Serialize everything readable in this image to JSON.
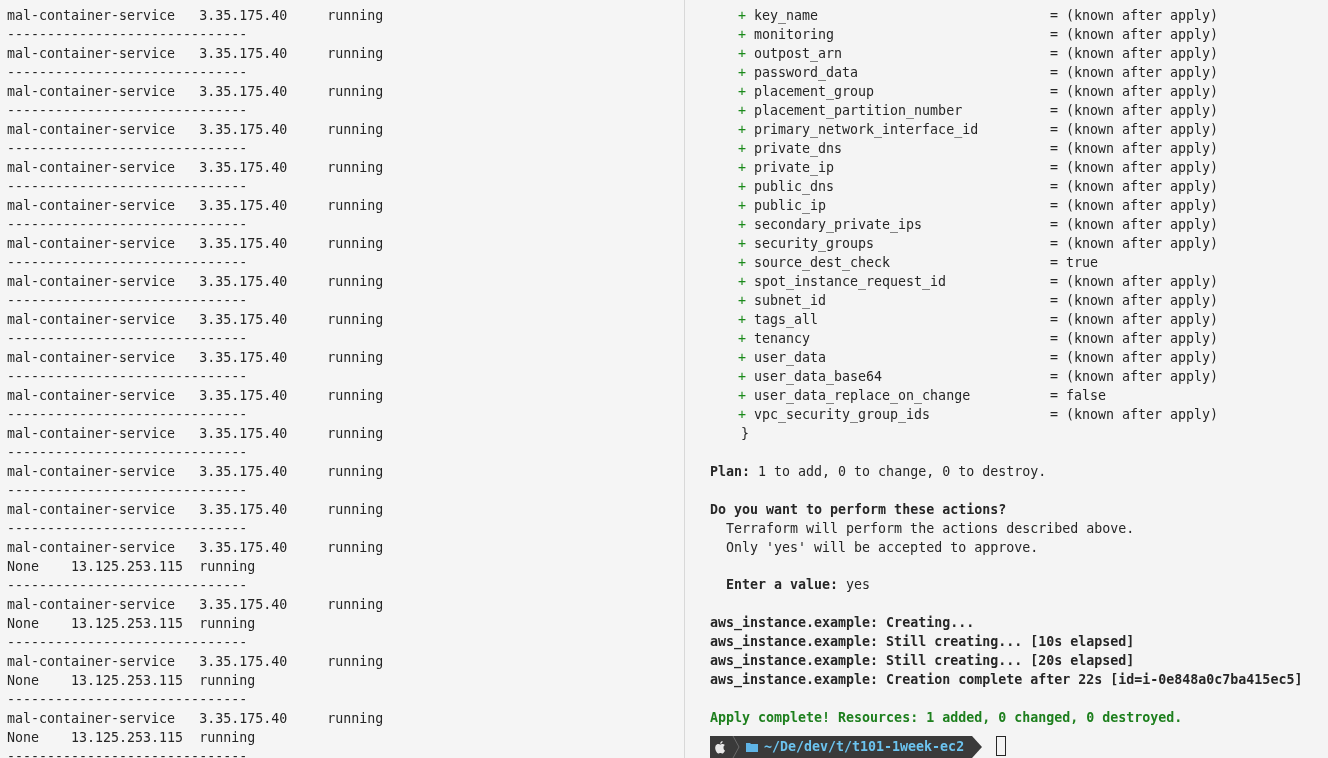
{
  "left_pane": {
    "lines": [
      "mal-container-service   3.35.175.40     running",
      "------------------------------",
      "mal-container-service   3.35.175.40     running",
      "------------------------------",
      "mal-container-service   3.35.175.40     running",
      "------------------------------",
      "mal-container-service   3.35.175.40     running",
      "------------------------------",
      "mal-container-service   3.35.175.40     running",
      "------------------------------",
      "mal-container-service   3.35.175.40     running",
      "------------------------------",
      "mal-container-service   3.35.175.40     running",
      "------------------------------",
      "mal-container-service   3.35.175.40     running",
      "------------------------------",
      "mal-container-service   3.35.175.40     running",
      "------------------------------",
      "mal-container-service   3.35.175.40     running",
      "------------------------------",
      "mal-container-service   3.35.175.40     running",
      "------------------------------",
      "mal-container-service   3.35.175.40     running",
      "------------------------------",
      "mal-container-service   3.35.175.40     running",
      "------------------------------",
      "mal-container-service   3.35.175.40     running",
      "------------------------------",
      "mal-container-service   3.35.175.40     running",
      "None    13.125.253.115  running",
      "------------------------------",
      "mal-container-service   3.35.175.40     running",
      "None    13.125.253.115  running",
      "------------------------------",
      "mal-container-service   3.35.175.40     running",
      "None    13.125.253.115  running",
      "------------------------------",
      "mal-container-service   3.35.175.40     running",
      "None    13.125.253.115  running",
      "------------------------------"
    ]
  },
  "right_pane": {
    "attributes": [
      {
        "sign": "+",
        "name": "key_name",
        "value": "= (known after apply)"
      },
      {
        "sign": "+",
        "name": "monitoring",
        "value": "= (known after apply)"
      },
      {
        "sign": "+",
        "name": "outpost_arn",
        "value": "= (known after apply)"
      },
      {
        "sign": "+",
        "name": "password_data",
        "value": "= (known after apply)"
      },
      {
        "sign": "+",
        "name": "placement_group",
        "value": "= (known after apply)"
      },
      {
        "sign": "+",
        "name": "placement_partition_number",
        "value": "= (known after apply)"
      },
      {
        "sign": "+",
        "name": "primary_network_interface_id",
        "value": "= (known after apply)"
      },
      {
        "sign": "+",
        "name": "private_dns",
        "value": "= (known after apply)"
      },
      {
        "sign": "+",
        "name": "private_ip",
        "value": "= (known after apply)"
      },
      {
        "sign": "+",
        "name": "public_dns",
        "value": "= (known after apply)"
      },
      {
        "sign": "+",
        "name": "public_ip",
        "value": "= (known after apply)"
      },
      {
        "sign": "+",
        "name": "secondary_private_ips",
        "value": "= (known after apply)"
      },
      {
        "sign": "+",
        "name": "security_groups",
        "value": "= (known after apply)"
      },
      {
        "sign": "+",
        "name": "source_dest_check",
        "value": "= true"
      },
      {
        "sign": "+",
        "name": "spot_instance_request_id",
        "value": "= (known after apply)"
      },
      {
        "sign": "+",
        "name": "subnet_id",
        "value": "= (known after apply)"
      },
      {
        "sign": "+",
        "name": "tags_all",
        "value": "= (known after apply)"
      },
      {
        "sign": "+",
        "name": "tenancy",
        "value": "= (known after apply)"
      },
      {
        "sign": "+",
        "name": "user_data",
        "value": "= (known after apply)"
      },
      {
        "sign": "+",
        "name": "user_data_base64",
        "value": "= (known after apply)"
      },
      {
        "sign": "+",
        "name": "user_data_replace_on_change",
        "value": "= false"
      },
      {
        "sign": "+",
        "name": "vpc_security_group_ids",
        "value": "= (known after apply)"
      }
    ],
    "closing_brace": "}",
    "output_blocks": [
      [
        {
          "text": "**Plan:** 1 to add, 0 to change, 0 to destroy.",
          "kind": "plain"
        }
      ],
      [
        {
          "text": "Do you want to perform these actions?",
          "kind": "bold"
        },
        {
          "text": "Terraform will perform the actions described above.",
          "kind": "note"
        },
        {
          "text": "Only 'yes' will be accepted to approve.",
          "kind": "note"
        }
      ],
      [
        {
          "text": "**Enter a value:** yes",
          "kind": "note"
        }
      ],
      [
        {
          "text": "aws_instance.example: Creating...",
          "kind": "bold"
        },
        {
          "text": "aws_instance.example: Still creating... [10s elapsed]",
          "kind": "bold"
        },
        {
          "text": "aws_instance.example: Still creating... [20s elapsed]",
          "kind": "bold"
        },
        {
          "text": "aws_instance.example: Creation complete after 22s [id=i-0e848a0c7ba415ec5]",
          "kind": "bold"
        }
      ],
      [
        {
          "text": "Apply complete! Resources: 1 added, 0 changed, 0 destroyed.",
          "kind": "success"
        }
      ]
    ],
    "prompt": {
      "path": "~/De/dev/t/t101-1week-ec2"
    }
  }
}
